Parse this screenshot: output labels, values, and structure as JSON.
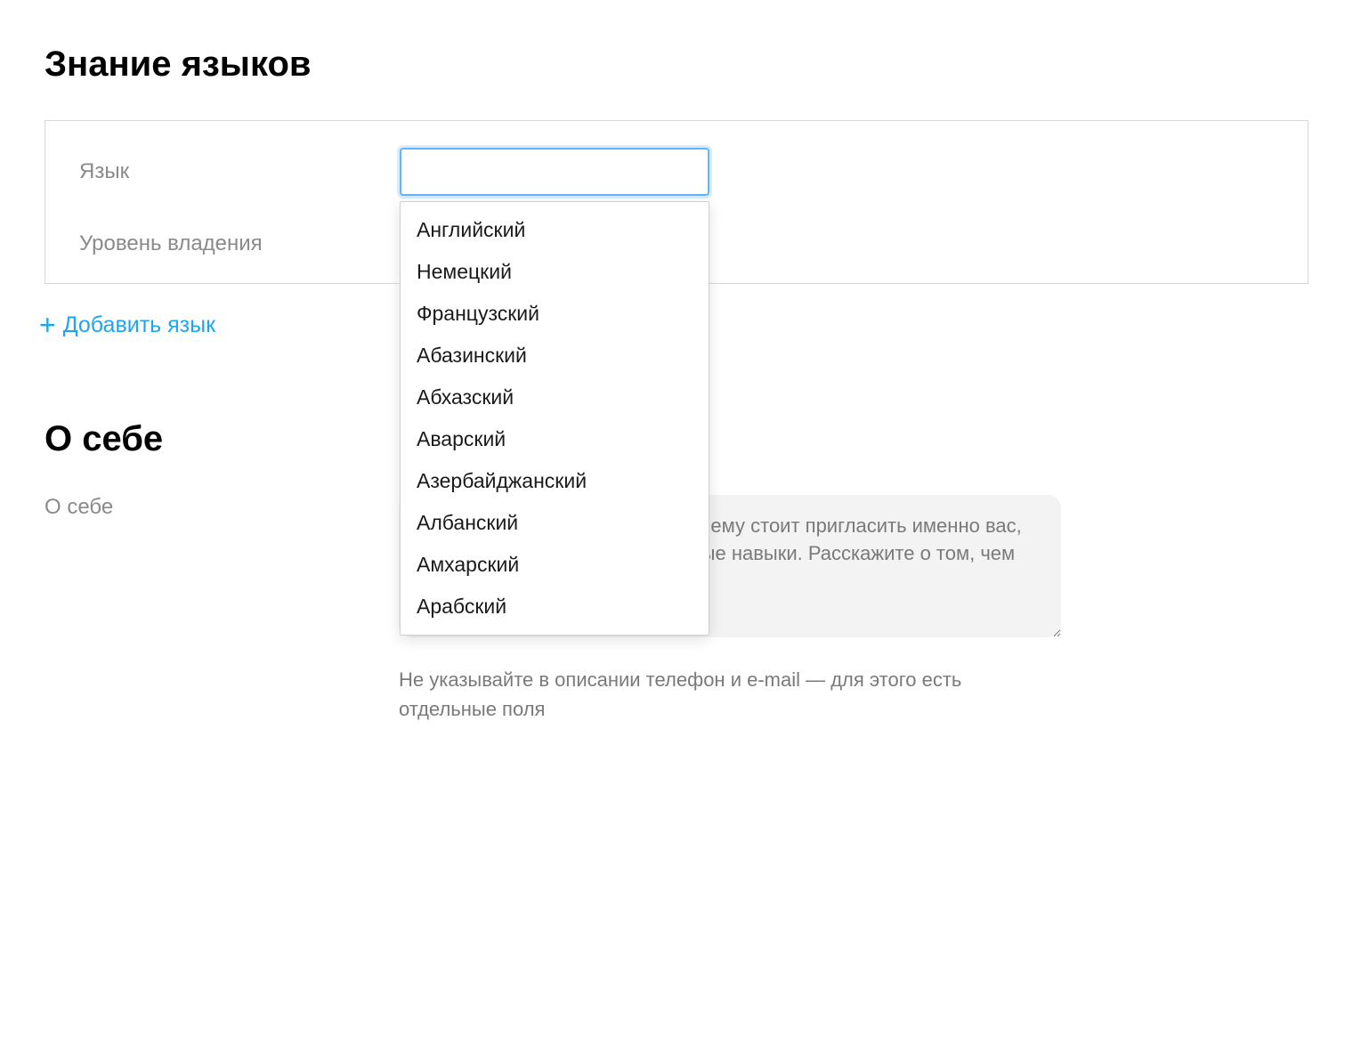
{
  "languages_section": {
    "title": "Знание языков",
    "field_language_label": "Язык",
    "field_level_label": "Уровень владения",
    "input_value": "",
    "dropdown_options": [
      "Английский",
      "Немецкий",
      "Французский",
      "Абазинский",
      "Абхазский",
      "Аварский",
      "Азербайджанский",
      "Албанский",
      "Амхарский",
      "Арабский"
    ],
    "add_language_label": "Добавить язык"
  },
  "about_section": {
    "title": "О себе",
    "subtitle": "О себе",
    "placeholder": "Чтобы работодатель понял, почему стоит пригласить именно вас, укажите свои профессиональные навыки. Расскажите о том, чем вы можете быть полезны",
    "hint": "Не указывайте в описании телефон и e-mail — для этого есть отдельные поля"
  }
}
